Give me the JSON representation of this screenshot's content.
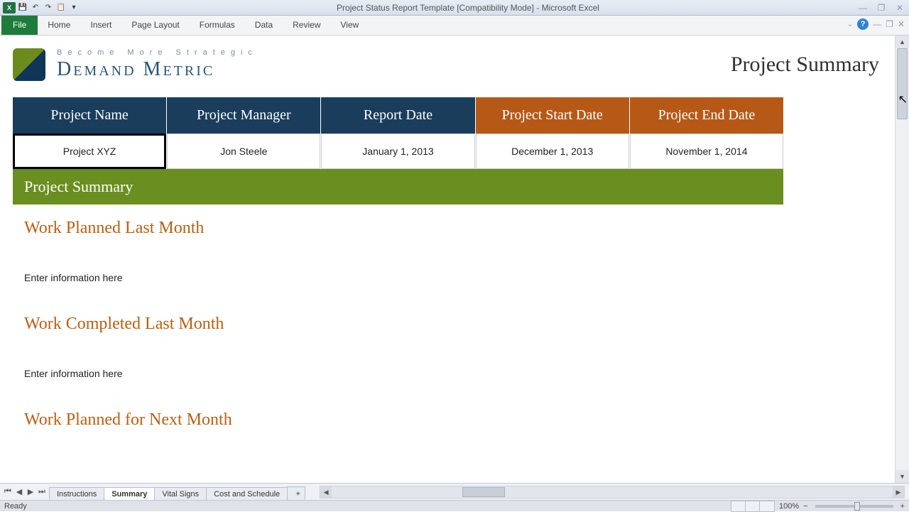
{
  "app": {
    "title": "Project Status Report Template  [Compatibility Mode]  -  Microsoft Excel"
  },
  "ribbon": {
    "file": "File",
    "tabs": [
      "Home",
      "Insert",
      "Page Layout",
      "Formulas",
      "Data",
      "Review",
      "View"
    ]
  },
  "brand": {
    "tagline": "Become More Strategic",
    "name": "Demand Metric"
  },
  "page_title": "Project Summary",
  "summary_table": {
    "headers": [
      {
        "label": "Project Name",
        "color": "blue"
      },
      {
        "label": "Project Manager",
        "color": "blue"
      },
      {
        "label": "Report Date",
        "color": "blue"
      },
      {
        "label": "Project Start Date",
        "color": "orange"
      },
      {
        "label": "Project End Date",
        "color": "orange"
      }
    ],
    "row": [
      "Project XYZ",
      "Jon Steele",
      "January 1, 2013",
      "December 1, 2013",
      "November 1, 2014"
    ]
  },
  "section_bar": "Project Summary",
  "sections": [
    {
      "title": "Work Planned Last Month",
      "body": "Enter information here"
    },
    {
      "title": "Work Completed Last Month",
      "body": "Enter information here"
    },
    {
      "title": "Work Planned for Next Month",
      "body": ""
    }
  ],
  "sheets": [
    "Instructions",
    "Summary",
    "Vital Signs",
    "Cost and Schedule"
  ],
  "active_sheet": "Summary",
  "status": {
    "left": "Ready",
    "zoom": "100%"
  }
}
